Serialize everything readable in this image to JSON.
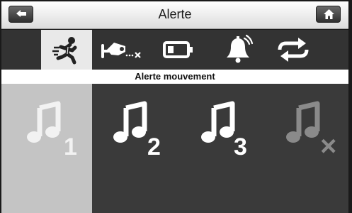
{
  "header": {
    "title": "Alerte"
  },
  "tabs": [
    {
      "name": "motion",
      "icon": "running-man-icon",
      "active": true
    },
    {
      "name": "camera-disconnect",
      "icon": "camera-off-icon",
      "active": false
    },
    {
      "name": "battery",
      "icon": "battery-icon",
      "active": false
    },
    {
      "name": "bell",
      "icon": "bell-ringing-icon",
      "active": false
    },
    {
      "name": "repeat",
      "icon": "repeat-icon",
      "active": false
    }
  ],
  "section": {
    "title": "Alerte mouvement"
  },
  "sounds": [
    {
      "label": "1",
      "selected": true
    },
    {
      "label": "2",
      "selected": false
    },
    {
      "label": "3",
      "selected": false
    },
    {
      "label": "×",
      "selected": false
    }
  ],
  "colors": {
    "selected_bg": "#c4c4c4",
    "panel_bg": "#3a3a3a",
    "toolbar_bg": "#333333"
  }
}
